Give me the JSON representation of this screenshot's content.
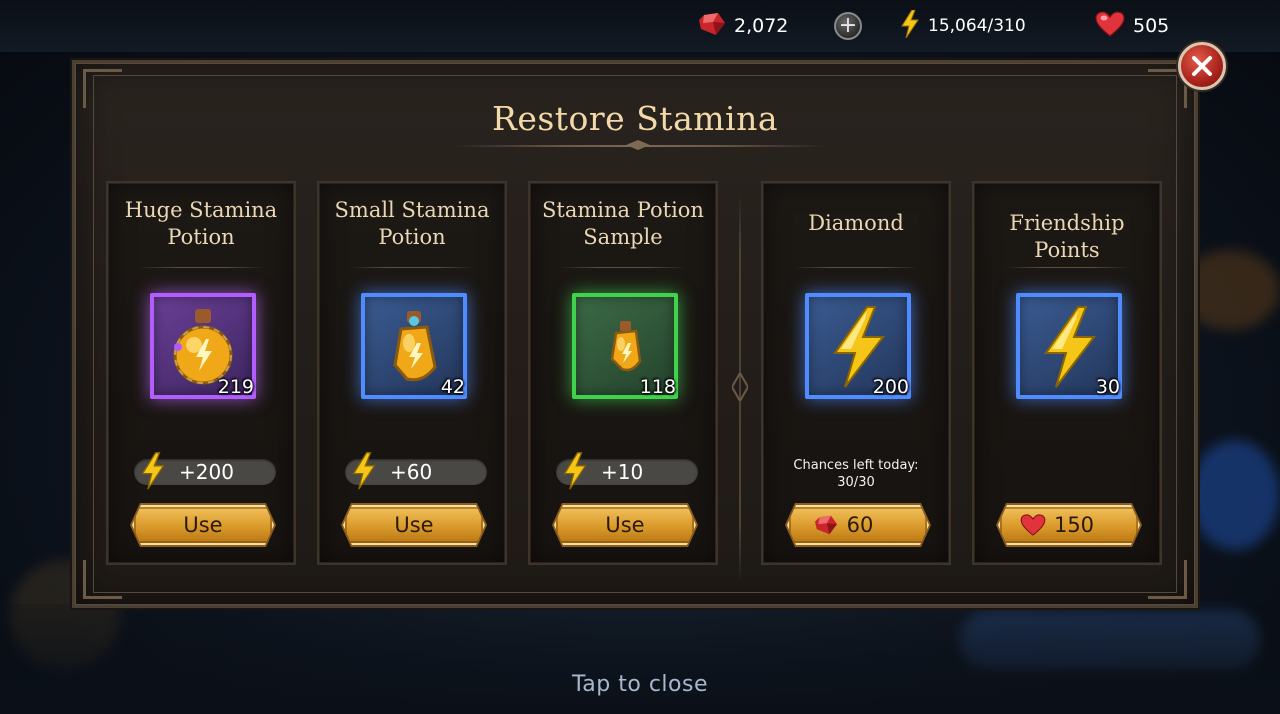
{
  "top_bar": {
    "gems": "2,072",
    "plus_label": "+",
    "stamina": "15,064/310",
    "hearts": "505"
  },
  "dialog": {
    "title": "Restore Stamina",
    "close_icon": "close-icon"
  },
  "cards": [
    {
      "name_line1": "Huge Stamina",
      "name_line2": "Potion",
      "count": "219",
      "bonus": "+200",
      "button": "Use",
      "frame_color": "#b35cff",
      "icon": "large-potion-icon"
    },
    {
      "name_line1": "Small Stamina",
      "name_line2": "Potion",
      "count": "42",
      "bonus": "+60",
      "button": "Use",
      "frame_color": "#4f8cff",
      "icon": "small-potion-icon"
    },
    {
      "name_line1": "Stamina Potion",
      "name_line2": "Sample",
      "count": "118",
      "bonus": "+10",
      "button": "Use",
      "frame_color": "#3fd24a",
      "icon": "sample-potion-icon"
    },
    {
      "name": "Diamond",
      "count": "200",
      "chances_label": "Chances left today:",
      "chances_value": "30/30",
      "cost": "60",
      "cost_icon": "gem-icon",
      "frame_color": "#4f8cff",
      "icon": "lightning-icon"
    },
    {
      "name": "Friendship Points",
      "count": "30",
      "cost": "150",
      "cost_icon": "heart-icon",
      "frame_color": "#4f8cff",
      "icon": "lightning-icon"
    }
  ],
  "footer": {
    "tap_to_close": "Tap to close"
  },
  "colors": {
    "accent_gold": "#d99a2a",
    "title": "#f4d9a8",
    "close_red": "#a31f17"
  }
}
